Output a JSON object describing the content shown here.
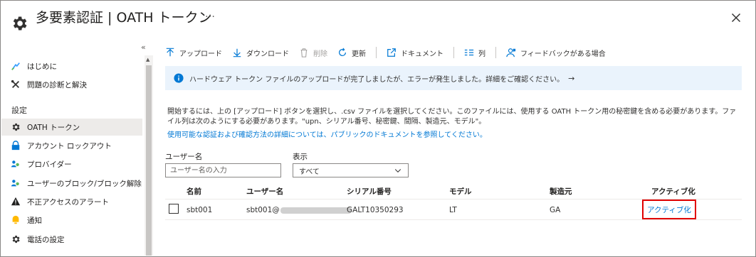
{
  "header": {
    "title": "多要素認証 | OATH トークン",
    "more": "…",
    "icon": "gear-icon",
    "close_icon": "close-icon"
  },
  "sidebar": {
    "collapse_glyph": "«",
    "items_top": [
      {
        "label": "はじめに",
        "icon": "quickstart-icon"
      },
      {
        "label": "問題の診断と解決",
        "icon": "wrench-icon"
      }
    ],
    "section": "設定",
    "items": [
      {
        "label": "OATH トークン",
        "icon": "gear-icon",
        "active": true
      },
      {
        "label": "アカウント ロックアウト",
        "icon": "lock-icon"
      },
      {
        "label": "プロバイダー",
        "icon": "people-icon"
      },
      {
        "label": "ユーザーのブロック/ブロック解除",
        "icon": "people-icon"
      },
      {
        "label": "不正アクセスのアラート",
        "icon": "warning-icon"
      },
      {
        "label": "通知",
        "icon": "bell-icon"
      },
      {
        "label": "電話の設定",
        "icon": "gear-icon"
      }
    ]
  },
  "toolbar": {
    "upload": "アップロード",
    "download": "ダウンロード",
    "delete": "削除",
    "refresh": "更新",
    "docs": "ドキュメント",
    "columns": "列",
    "feedback": "フィードバックがある場合"
  },
  "info": {
    "message": "ハードウェア トークン ファイルのアップロードが完了しましたが、エラーが発生しました。詳細をご確認ください。",
    "arrow": "→"
  },
  "description": {
    "text": "開始するには、上の [アップロード] ボタンを選択し、.csv ファイルを選択してください。このファイルには、使用する OATH トークン用の秘密鍵を含める必要があります。ファイル列は次のようにする必要があります。\"upn、シリアル番号、秘密鍵、間隔、製造元、モデル\"。",
    "link": "使用可能な認証および確認方法の詳細については、パブリックのドキュメントを参照してください。"
  },
  "filters": {
    "username_label": "ユーザー名",
    "username_placeholder": "ユーザー名の入力",
    "display_label": "表示",
    "display_value": "すべて"
  },
  "table": {
    "headers": [
      "名前",
      "ユーザー名",
      "シリアル番号",
      "モデル",
      "製造元",
      "アクティブ化"
    ],
    "rows": [
      {
        "name": "sbt001",
        "username": "sbt001@",
        "serial": "GALT10350293",
        "model": "LT",
        "manufacturer": "GA",
        "action": "アクティブ化"
      }
    ]
  },
  "colors": {
    "accent": "#0078d4",
    "highlight_border": "#e00000",
    "info_bg": "#eaf3fc"
  }
}
